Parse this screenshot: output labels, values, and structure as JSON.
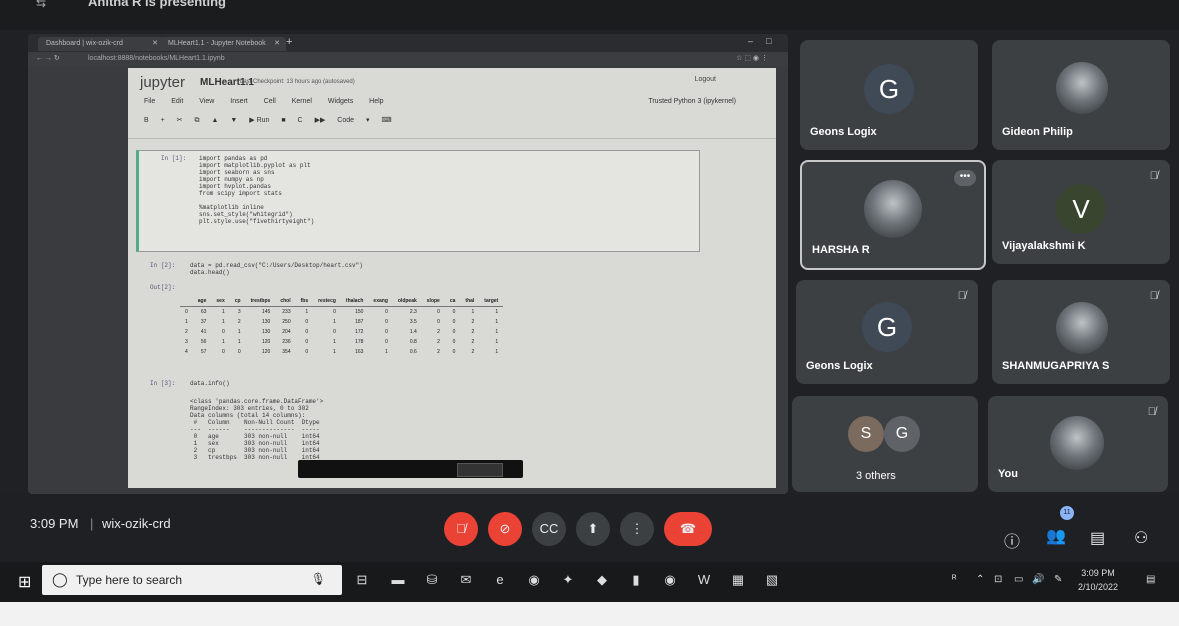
{
  "banner": {
    "text": "Anitha R is presenting"
  },
  "browser": {
    "tabs": [
      {
        "label": "Dashboard | wix-ozik-crd"
      },
      {
        "label": "MLHeart1.1 - Jupyter Notebook"
      }
    ],
    "url": "localhost:8888/notebooks/MLHeart1.1.ipynb"
  },
  "jupyter": {
    "logo": "jupyter",
    "notebook_name": "MLHeart1.1",
    "checkpoint": "Last Checkpoint: 13 hours ago (autosaved)",
    "logout": "Logout",
    "menu": [
      "File",
      "Edit",
      "View",
      "Insert",
      "Cell",
      "Kernel",
      "Widgets",
      "Help"
    ],
    "kernel": "Trusted  Python 3 (ipykernel)",
    "toolbar": [
      "B",
      "+",
      "✂",
      "⧉",
      "▲",
      "▼",
      "▶ Run",
      "■",
      "C",
      "▶▶",
      "Code",
      "▾",
      "⌨"
    ],
    "cells": [
      {
        "prompt": "In [1]:",
        "code": "import pandas as pd\nimport matplotlib.pyplot as plt\nimport seaborn as sns\nimport numpy as np\nimport hvplot.pandas\nfrom scipy import stats\n\n%matplotlib inline\nsns.set_style(\"whitegrid\")\nplt.style.use(\"fivethirtyeight\")"
      },
      {
        "prompt": "In [2]:",
        "code": "data = pd.read_csv(\"C:/Users/Desktop/heart.csv\")\ndata.head()"
      },
      {
        "prompt": "Out[2]:",
        "code": ""
      },
      {
        "prompt": "In [3]:",
        "code": "data.info()"
      },
      {
        "prompt": "",
        "code": "<class 'pandas.core.frame.DataFrame'>\nRangeIndex: 303 entries, 0 to 302\nData columns (total 14 columns):\n #   Column    Non-Null Count  Dtype\n---  ------    --------------  -----\n 0   age       303 non-null    int64\n 1   sex       303 non-null    int64\n 2   cp        303 non-null    int64\n 3   trestbps  303 non-null    int64"
      }
    ],
    "table": {
      "columns": [
        "",
        "age",
        "sex",
        "cp",
        "trestbps",
        "chol",
        "fbs",
        "restecg",
        "thalach",
        "exang",
        "oldpeak",
        "slope",
        "ca",
        "thal",
        "target"
      ],
      "rows": [
        [
          "0",
          "63",
          "1",
          "3",
          "145",
          "233",
          "1",
          "0",
          "150",
          "0",
          "2.3",
          "0",
          "0",
          "1",
          "1"
        ],
        [
          "1",
          "37",
          "1",
          "2",
          "130",
          "250",
          "0",
          "1",
          "187",
          "0",
          "3.5",
          "0",
          "0",
          "2",
          "1"
        ],
        [
          "2",
          "41",
          "0",
          "1",
          "130",
          "204",
          "0",
          "0",
          "172",
          "0",
          "1.4",
          "2",
          "0",
          "2",
          "1"
        ],
        [
          "3",
          "56",
          "1",
          "1",
          "120",
          "236",
          "0",
          "1",
          "178",
          "0",
          "0.8",
          "2",
          "0",
          "2",
          "1"
        ],
        [
          "4",
          "57",
          "0",
          "0",
          "120",
          "354",
          "0",
          "1",
          "163",
          "1",
          "0.6",
          "2",
          "0",
          "2",
          "1"
        ]
      ]
    }
  },
  "participants": [
    {
      "name": "Geons Logix",
      "initial": "G",
      "color": "#3f4a56"
    },
    {
      "name": "Gideon Philip",
      "initial": "",
      "color": ""
    },
    {
      "name": "HARSHA R",
      "initial": "",
      "color": ""
    },
    {
      "name": "Vijayalakshmi K",
      "initial": "V",
      "color": "#3a4530"
    },
    {
      "name": "Geons Logix",
      "initial": "G",
      "color": "#3f4a56"
    },
    {
      "name": "SHANMUGAPRIYA S",
      "initial": "",
      "color": ""
    },
    {
      "name": "3 others",
      "initial": "S",
      "initial2": "G",
      "color": "#5f6368"
    },
    {
      "name": "You",
      "initial": "",
      "color": ""
    }
  ],
  "meeting": {
    "time": "3:09 PM",
    "code": "wix-ozik-crd",
    "participants_count": "11"
  },
  "taskbar": {
    "search_placeholder": "Type here to search",
    "clock_time": "3:09 PM",
    "clock_date": "2/10/2022"
  }
}
